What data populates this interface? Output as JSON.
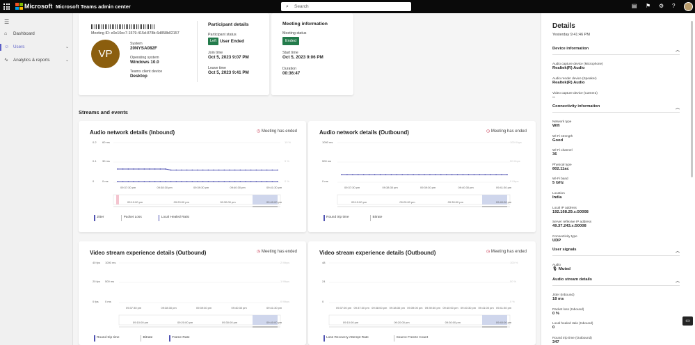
{
  "topbar": {
    "brand": "Microsoft",
    "app_name": "Microsoft Teams admin center",
    "search_placeholder": "Search",
    "ms_colors": [
      "#f25022",
      "#7fba00",
      "#00a4ef",
      "#ffb900"
    ]
  },
  "nav": {
    "items": [
      {
        "label": "Dashboard",
        "icon": "home-icon"
      },
      {
        "label": "Users",
        "icon": "users-icon"
      },
      {
        "label": "Analytics & reports",
        "icon": "chart-icon"
      }
    ]
  },
  "participant": {
    "meeting_id": "Meeting ID: e0e10ec7-1579-415d-878b-6d858b02157",
    "initials": "VP",
    "system_label": "System",
    "system_value": "20NYSA082F",
    "os_label": "Operating system",
    "os_value": "Windows 10.0",
    "client_label": "Teams client device",
    "client_value": "Desktop",
    "details_title": "Participant details",
    "status_label": "Participant status",
    "status_badge": "Left",
    "status_value": "User Ended",
    "join_label": "Join time",
    "join_value": "Oct 5, 2023 9:07 PM",
    "leave_label": "Leave time",
    "leave_value": "Oct 5, 2023 9:41 PM"
  },
  "meeting": {
    "title": "Meeting information",
    "status_label": "Meeting status",
    "status_badge": "Ended",
    "start_label": "Start time",
    "start_value": "Oct 5, 2023 9:06 PM",
    "duration_label": "Duration",
    "duration_value": "00:36:47"
  },
  "streams_title": "Streams and events",
  "ended_text": "Meeting has ended",
  "charts": {
    "c1": {
      "title": "Audio network details (Inbound)",
      "y_left": [
        "0.2",
        "0.1",
        "0"
      ],
      "y_mid": [
        "60 ms",
        "30 ms",
        "0 ms"
      ],
      "y_right": [
        "10 %",
        "5 %",
        "0 %"
      ],
      "x": [
        "09:37:30 pm",
        "09:38:30 pm",
        "09:39:30 pm",
        "09:40:30 pm",
        "09:41:30 pm"
      ],
      "nav": [
        "09:10:00 pm",
        "09:20:00 pm",
        "09:30:00 pm",
        "09:40:00 pm"
      ],
      "legend": [
        "Jitter",
        "Packet Loss",
        "Local Healed Ratio"
      ]
    },
    "c2": {
      "title": "Audio network details (Outbound)",
      "y_left": [
        "1000 ms",
        "500 ms",
        "0 ms"
      ],
      "y_right": [
        "100 Kbps",
        "50 Kbps",
        "0 Kbps"
      ],
      "x": [
        "09:37:30 pm",
        "09:38:30 pm",
        "09:39:30 pm",
        "09:40:30 pm",
        "09:41:30 pm"
      ],
      "nav": [
        "09:10:00 pm",
        "09:20:00 pm",
        "09:30:00 pm",
        "09:40:00 pm"
      ],
      "legend": [
        "Round trip time",
        "Bitrate"
      ]
    },
    "c3": {
      "title": "Video stream experience details (Outbound)",
      "y_left": [
        "40 fps",
        "20 fps",
        "0 fps"
      ],
      "y_mid": [
        "1000 ms",
        "500 ms",
        "0 ms"
      ],
      "y_right": [
        "2 Mbps",
        "1 Mbps",
        "0 Mbps"
      ],
      "x": [
        "09:37:30 pm",
        "09:38:30 pm",
        "09:39:30 pm",
        "09:40:30 pm",
        "09:41:30 pm"
      ],
      "nav": [
        "09:10:00 pm",
        "09:20:00 pm",
        "09:30:00 pm",
        "09:40:00 pm"
      ],
      "legend": [
        "Round trip time",
        "Bitrate",
        "Frame Rate"
      ]
    },
    "c4": {
      "title": "Video stream experience details (Outbound)",
      "y_left": [
        "48",
        "24",
        "0"
      ],
      "y_right": [
        "100 %",
        "50 %",
        "0 %"
      ],
      "x": [
        "09:37:00 pm",
        "09:37:30 pm",
        "09:38:00 pm",
        "09:38:30 pm",
        "09:39:00 pm",
        "09:39:30 pm",
        "09:40:00 pm",
        "09:40:30 pm",
        "09:41:00 pm",
        "09:41:30 pm"
      ],
      "nav": [
        "09:10:00 pm",
        "09:20:00 pm",
        "09:30:00 pm",
        "09:40:00 pm"
      ],
      "legend": [
        "Loss Recovery Attempt Rate",
        "Source Freeze Count"
      ]
    }
  },
  "details": {
    "title": "Details",
    "subtitle": "Yesterday 9:41:46 PM",
    "device_head": "Device information",
    "device": [
      {
        "label": "Audio capture device (Microphone)",
        "value": "Realtek(R) Audio"
      },
      {
        "label": "Audio render device (Speaker)",
        "value": "Realtek(R) Audio"
      },
      {
        "label": "Video capture device (Camera)",
        "value": "--"
      }
    ],
    "conn_head": "Connectivity information",
    "conn": [
      {
        "label": "Network type",
        "value": "Wifi"
      },
      {
        "label": "Wi-Fi strength",
        "value": "Good"
      },
      {
        "label": "Wi-Fi channel",
        "value": "36"
      },
      {
        "label": "Physical type",
        "value": "802.11ac"
      },
      {
        "label": "Wi-Fi band",
        "value": "5 GHz"
      },
      {
        "label": "Location",
        "value": "India"
      },
      {
        "label": "Local IP address",
        "value": "192.168.29.x:50008"
      },
      {
        "label": "Server reflexive IP address",
        "value": "49.37.243.x:50008"
      },
      {
        "label": "Connectivity type",
        "value": "UDP"
      }
    ],
    "signals_head": "User signals",
    "audio_label": "Audio",
    "audio_value": "Muted",
    "stream_head": "Audio stream details",
    "stream": [
      {
        "label": "Jitter (Inbound)",
        "value": "18 ms"
      },
      {
        "label": "Packet loss (Inbound)",
        "value": "0 %"
      },
      {
        "label": "Local healed ratio (Inbound)",
        "value": "0"
      },
      {
        "label": "Round trip time (Outbound)",
        "value": "347"
      }
    ]
  },
  "colors": {
    "accent": "#5b5fc7",
    "green": "#237b4b",
    "ended_icon": "#c4314b"
  }
}
